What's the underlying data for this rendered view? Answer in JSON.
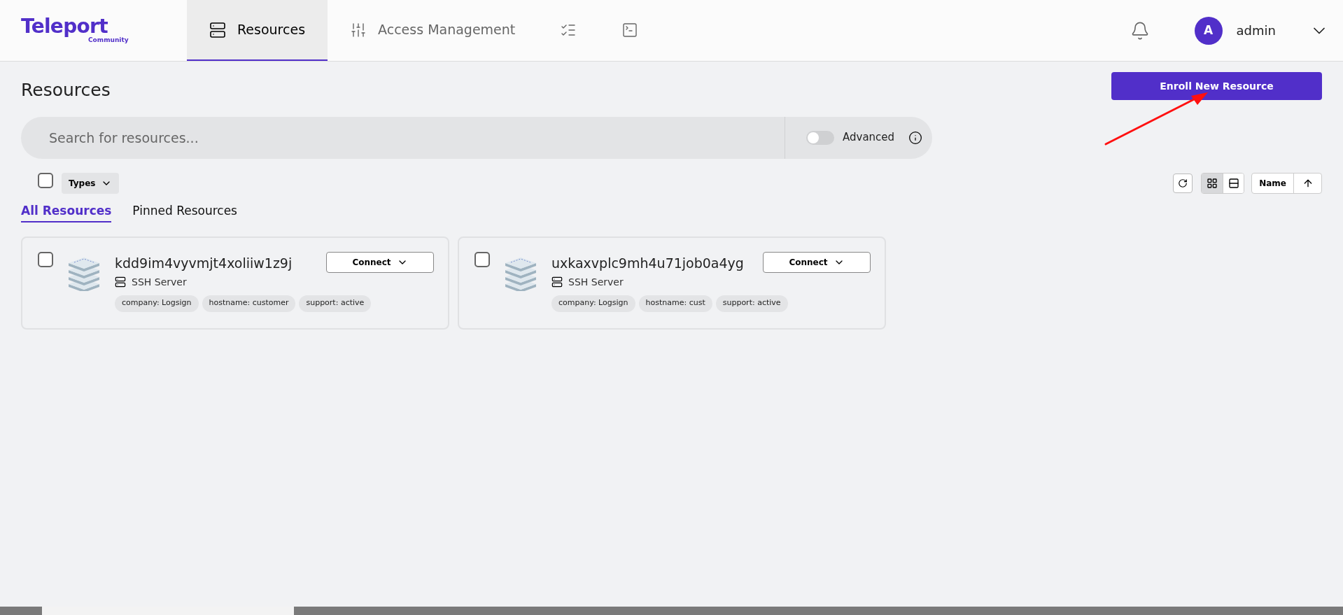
{
  "logo": {
    "name": "Teleport",
    "edition": "Community"
  },
  "nav": [
    {
      "kind": "resources",
      "label": "Resources",
      "selected": true
    },
    {
      "kind": "access",
      "label": "Access Management",
      "selected": false
    },
    {
      "kind": "checklist",
      "selected": false
    },
    {
      "kind": "terminal",
      "selected": false
    }
  ],
  "user": {
    "initial": "A",
    "name": "admin"
  },
  "page_title": "Resources",
  "enroll_button": "Enroll New Resource",
  "search": {
    "placeholder": "Search for resources...",
    "advanced_label": "Advanced",
    "advanced_on": false
  },
  "filters": {
    "select_all_checked": false,
    "types_label": "Types",
    "views": [
      {
        "kind": "grid",
        "selected": true
      },
      {
        "kind": "list",
        "selected": false
      }
    ],
    "sort_label": "Name"
  },
  "tabs": [
    {
      "label": "All Resources",
      "selected": true
    },
    {
      "label": "Pinned Resources",
      "selected": false
    }
  ],
  "resources": [
    {
      "name": "kdd9im4vyvmjt4xoliiw1z9j",
      "type": "SSH Server",
      "checked": false,
      "connect": "Connect",
      "labels": [
        "company: Logsign",
        "hostname: customer",
        "support: active"
      ]
    },
    {
      "name": "uxkaxvplc9mh4u71job0a4yg",
      "type": "SSH Server",
      "checked": false,
      "connect": "Connect",
      "labels": [
        "company: Logsign",
        "hostname: cust",
        "support: active"
      ]
    }
  ]
}
